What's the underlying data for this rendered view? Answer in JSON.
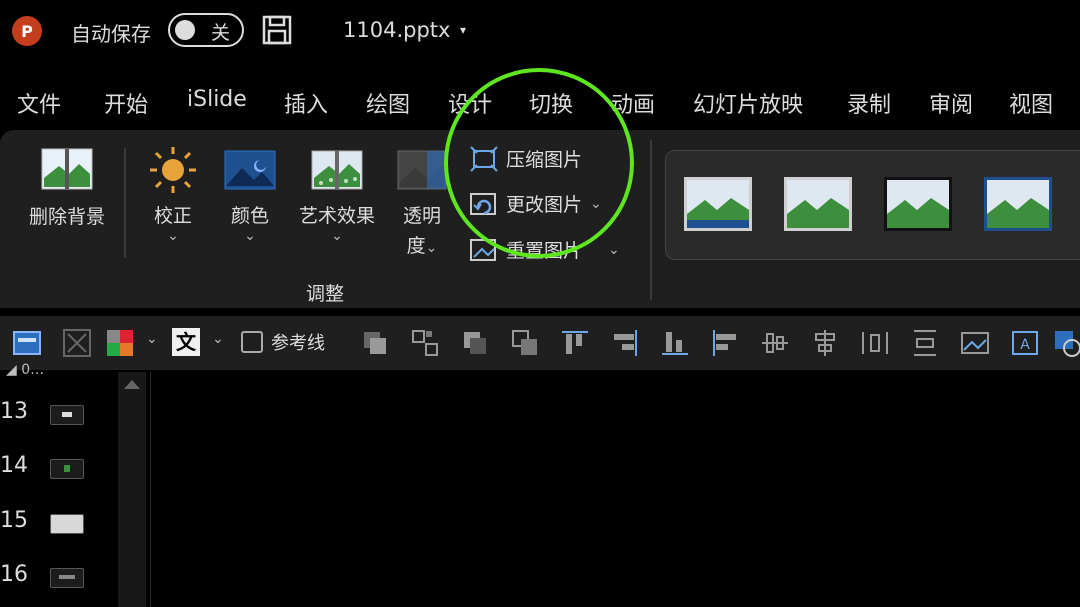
{
  "titlebar": {
    "logo_letter": "P",
    "autosave_label": "自动保存",
    "autosave_state": "关",
    "filename": "1104.pptx",
    "filename_caret": "▾"
  },
  "menu": [
    "文件",
    "开始",
    "iSlide",
    "插入",
    "绘图",
    "设计",
    "切换",
    "动画",
    "幻灯片放映",
    "录制",
    "审阅",
    "视图"
  ],
  "ribbon": {
    "remove_bg": "删除背景",
    "corrections": "校正",
    "color": "颜色",
    "artistic": "艺术效果",
    "transparency_line1": "透明",
    "transparency_line2": "度",
    "compress": "压缩图片",
    "change": "更改图片",
    "reset": "重置图片",
    "group_label": "调整",
    "caret": "⌄"
  },
  "qat": {
    "text_glyph": "文",
    "ref_lines": "参考线",
    "caret": "⌄"
  },
  "slides": {
    "panel_header": "◢ 0…",
    "numbers": [
      "13",
      "14",
      "15",
      "16"
    ]
  },
  "colors": {
    "highlight": "#5ee61f",
    "ribbon_bg": "#1f1f1f",
    "ppt_red": "#c43e1c"
  }
}
